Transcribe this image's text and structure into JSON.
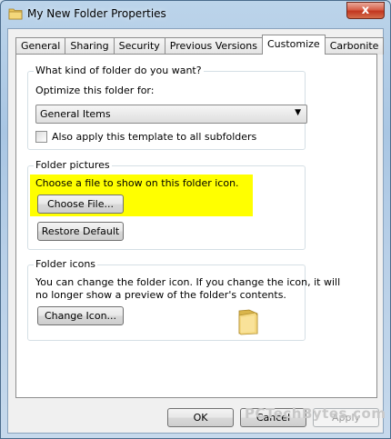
{
  "window": {
    "title": "My New Folder Properties",
    "close_glyph": "x",
    "title_icon": "folder-icon"
  },
  "tabs": [
    {
      "label": "General",
      "active": false
    },
    {
      "label": "Sharing",
      "active": false
    },
    {
      "label": "Security",
      "active": false
    },
    {
      "label": "Previous Versions",
      "active": false
    },
    {
      "label": "Customize",
      "active": true
    },
    {
      "label": "Carbonite",
      "active": false
    }
  ],
  "folder_type": {
    "title": "What kind of folder do you want?",
    "optimize_label": "Optimize this folder for:",
    "selected_option": "General Items",
    "apply_subfolders_label": "Also apply this template to all subfolders",
    "apply_subfolders_checked": false
  },
  "folder_pictures": {
    "title": "Folder pictures",
    "instruction": "Choose a file to show on this folder icon.",
    "choose_file_label": "Choose File...",
    "restore_default_label": "Restore Default",
    "highlight_color": "#ffff00"
  },
  "folder_icons": {
    "title": "Folder icons",
    "description_line1": "You can change the folder icon. If you change the icon, it will",
    "description_line2": "no longer show a preview of the folder's contents.",
    "change_icon_label": "Change Icon...",
    "preview_icon": "folder-icon"
  },
  "footer": {
    "ok_label": "OK",
    "cancel_label": "Cancel",
    "apply_label": "Apply",
    "apply_enabled": false
  },
  "watermark": "PCTechBytes.com"
}
